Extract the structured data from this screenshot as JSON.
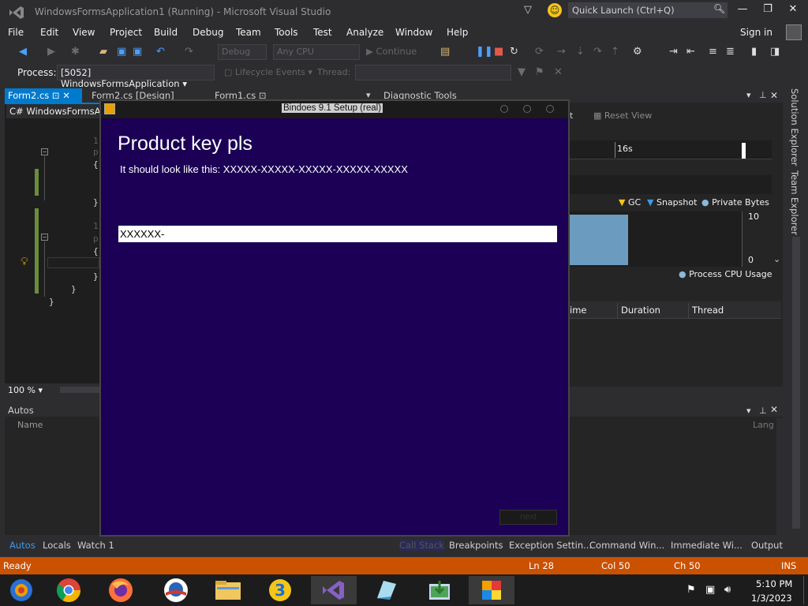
{
  "ide": {
    "title": "WindowsFormsApplication1 (Running) - Microsoft Visual Studio",
    "quick_launch_placeholder": "Quick Launch (Ctrl+Q)",
    "menu": [
      "File",
      "Edit",
      "View",
      "Project",
      "Build",
      "Debug",
      "Team",
      "Tools",
      "Test",
      "Analyze",
      "Window",
      "Help"
    ],
    "sign_in": "Sign in",
    "toolbar": {
      "config": "Debug",
      "platform": "Any CPU",
      "continue": "Continue"
    },
    "process_label": "Process:",
    "process_value": "[5052] WindowsFormsApplication",
    "lifecycle": "Lifecycle Events",
    "thread_label": "Thread:",
    "tabs": [
      "Form2.cs",
      "Form2.cs [Design]",
      "Form1.cs"
    ],
    "nav_dropdown": "WindowsFormsAp",
    "zoom": "100 %",
    "diagnostic": {
      "tab": "Diagnostic Tools",
      "reset_view": "Reset View",
      "time_marker": "16s",
      "legend": [
        "GC",
        "Snapshot",
        "Private Bytes"
      ],
      "axis_max": "10",
      "axis_min": "0",
      "cpu_legend": "Process CPU Usage",
      "columns": [
        "ime",
        "Duration",
        "Thread"
      ]
    },
    "side_tabs": [
      "Solution Explorer",
      "Team Explorer"
    ],
    "autos": {
      "title": "Autos",
      "name_col": "Name",
      "lang_col": "Lang"
    },
    "bottom_tabs": [
      "Autos",
      "Locals",
      "Watch 1",
      "Call Stack",
      "Breakpoints",
      "Exception Settin...",
      "Command Win...",
      "Immediate Wi...",
      "Output"
    ],
    "status": {
      "ready": "Ready",
      "ln": "Ln 28",
      "col": "Col 50",
      "ch": "Ch 50",
      "ins": "INS"
    }
  },
  "setup": {
    "title": "Bindoes 9.1 Setup (real)",
    "heading": "Product key pls",
    "subtitle": "It should look like this: XXXXX-XXXXX-XXXXX-XXXXX-XXXXX",
    "key_value": "XXXXXX-",
    "next_label": "next"
  },
  "taskbar": {
    "time": "5:10 PM",
    "date": "1/3/2023"
  },
  "colors": {
    "setup_bg": "#1b0055",
    "status_bar": "#ca5100",
    "accent": "#007acc"
  }
}
